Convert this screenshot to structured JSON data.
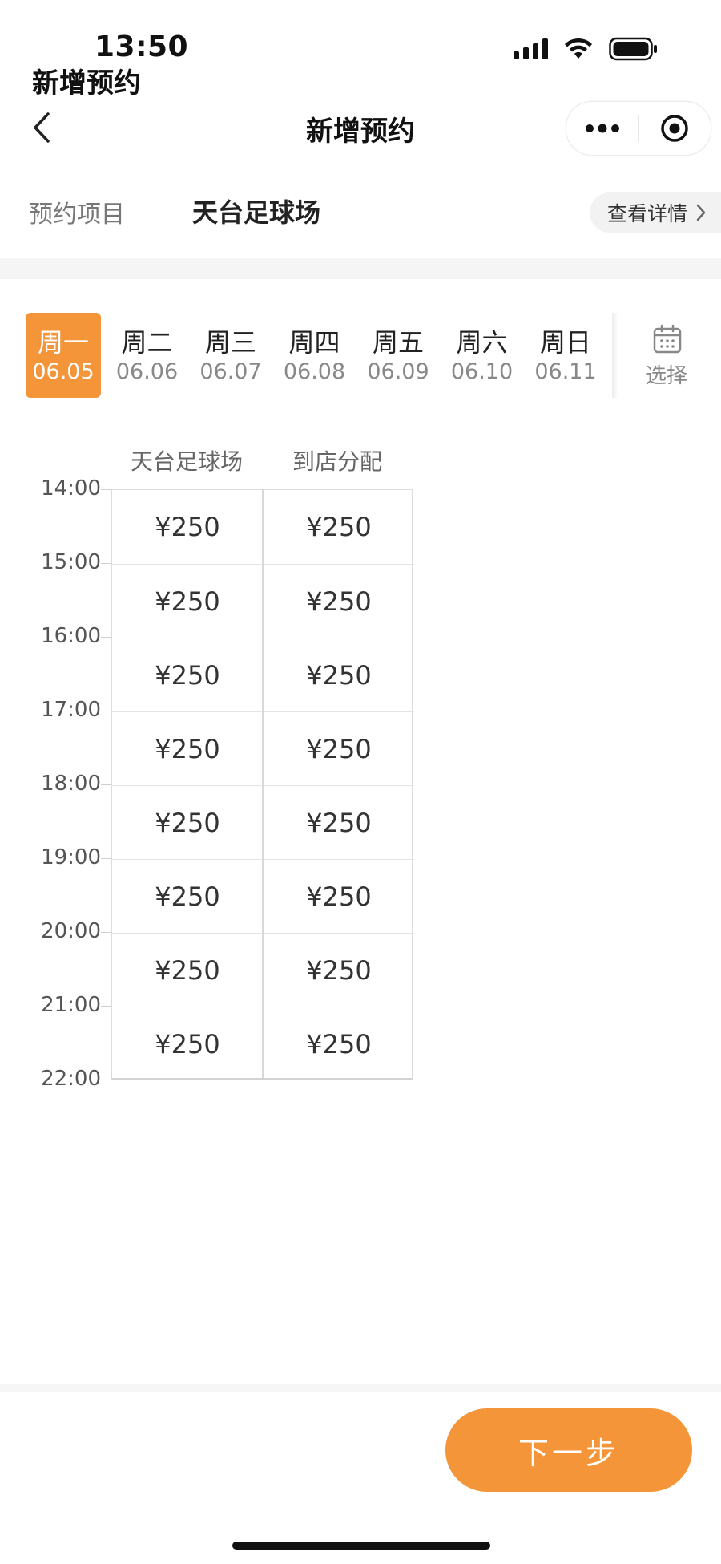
{
  "status_bar": {
    "time": "13:50",
    "overlay_title": "新增预约",
    "icons": [
      "signal-icon",
      "wifi-icon",
      "battery-icon"
    ]
  },
  "nav": {
    "title": "新增预约",
    "back_icon": "chevron-left-icon",
    "capsule_icons": [
      "more-icon",
      "close-target-icon"
    ]
  },
  "project": {
    "label": "预约项目",
    "name": "天台足球场",
    "details_label": "查看详情"
  },
  "dates": [
    {
      "weekday": "周一",
      "date": "06.05",
      "selected": true
    },
    {
      "weekday": "周二",
      "date": "06.06",
      "selected": false
    },
    {
      "weekday": "周三",
      "date": "06.07",
      "selected": false
    },
    {
      "weekday": "周四",
      "date": "06.08",
      "selected": false
    },
    {
      "weekday": "周五",
      "date": "06.09",
      "selected": false
    },
    {
      "weekday": "周六",
      "date": "06.10",
      "selected": false
    },
    {
      "weekday": "周日",
      "date": "06.11",
      "selected": false
    }
  ],
  "calendar": {
    "label": "选择",
    "icon": "calendar-icon"
  },
  "schedule": {
    "columns": [
      "天台足球场",
      "到店分配"
    ],
    "times": [
      "14:00",
      "15:00",
      "16:00",
      "17:00",
      "18:00",
      "19:00",
      "20:00",
      "21:00",
      "22:00"
    ],
    "slots": [
      [
        "¥250",
        "¥250"
      ],
      [
        "¥250",
        "¥250"
      ],
      [
        "¥250",
        "¥250"
      ],
      [
        "¥250",
        "¥250"
      ],
      [
        "¥250",
        "¥250"
      ],
      [
        "¥250",
        "¥250"
      ],
      [
        "¥250",
        "¥250"
      ],
      [
        "¥250",
        "¥250"
      ]
    ]
  },
  "footer": {
    "next_label": "下一步"
  },
  "colors": {
    "accent": "#f5953a",
    "text_primary": "#222222",
    "text_secondary": "#888888",
    "grid_line": "#dcdcdc"
  }
}
